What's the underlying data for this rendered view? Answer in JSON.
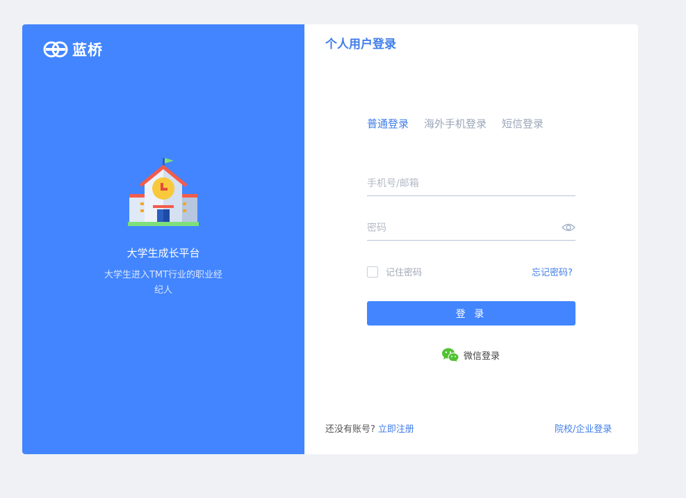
{
  "brand": {
    "name": "蓝桥",
    "logo_icon": "blue-bridge-logo-icon"
  },
  "left_panel": {
    "illustration_icon": "school-building-icon",
    "slogan": "大学生成长平台",
    "subtitle": "大学生进入TMT行业的职业经纪人"
  },
  "login": {
    "title": "个人用户登录",
    "tabs": [
      {
        "label": "普通登录",
        "active": true
      },
      {
        "label": "海外手机登录",
        "active": false
      },
      {
        "label": "短信登录",
        "active": false
      }
    ],
    "account": {
      "placeholder": "手机号/邮箱",
      "value": ""
    },
    "password": {
      "placeholder": "密码",
      "value": ""
    },
    "remember_label": "记住密码",
    "remember_checked": false,
    "forgot_label": "忘记密码?",
    "submit_label": "登 录",
    "wechat_label": "微信登录",
    "no_account_text": "还没有账号?",
    "register_label": "立即注册",
    "org_login_label": "院校/企业登录"
  },
  "colors": {
    "primary": "#4285ff",
    "link": "#3f7de8",
    "background": "#f0f1f5",
    "wechat": "#51c332"
  }
}
